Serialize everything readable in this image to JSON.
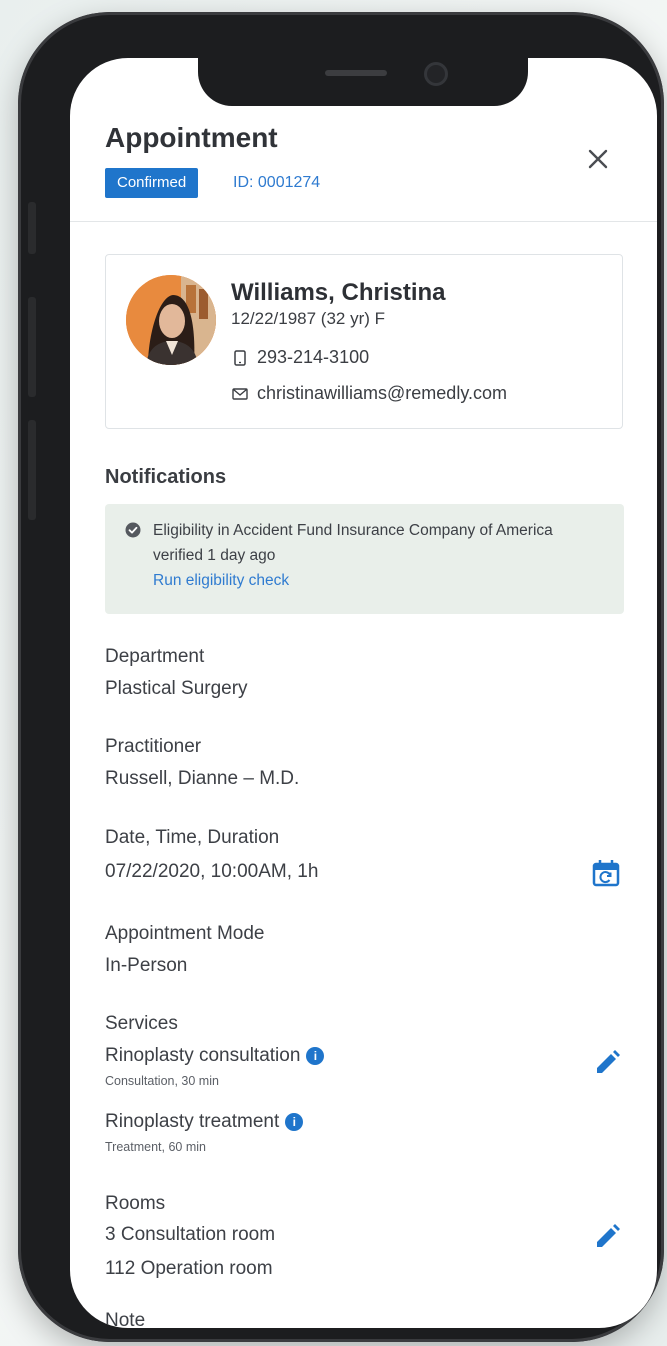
{
  "header": {
    "title": "Appointment",
    "status_badge": "Confirmed",
    "appointment_id": "ID: 0001274",
    "close_icon": "close-icon"
  },
  "patient": {
    "name": "Williams, Christina",
    "dob_age_sex": "12/22/1987 (32 yr) F",
    "phone": "293-214-3100",
    "email": "christinawilliams@remedly.com"
  },
  "notifications": {
    "heading": "Notifications",
    "message": "Eligibility in Accident Fund Insurance Company of America verified 1 day ago",
    "link": "Run eligibility check"
  },
  "details": {
    "department_label": "Department",
    "department_value": "Plastical Surgery",
    "practitioner_label": "Practitioner",
    "practitioner_value": "Russell, Dianne – M.D.",
    "datetime_label": "Date, Time, Duration",
    "datetime_value": "07/22/2020, 10:00AM, 1h",
    "mode_label": "Appointment Mode",
    "mode_value": "In-Person",
    "services_label": "Services",
    "services": [
      {
        "name": "Rinoplasty consultation",
        "note": "Consultation, 30 min"
      },
      {
        "name": "Rinoplasty treatment",
        "note": "Treatment, 60 min"
      }
    ],
    "rooms_label": "Rooms",
    "rooms": [
      "3 Consultation room",
      "112 Operation room"
    ],
    "notes_label": "Note"
  },
  "colors": {
    "accent": "#1f75cb",
    "link": "#2f7bd0",
    "notification_bg": "#e9efea"
  }
}
